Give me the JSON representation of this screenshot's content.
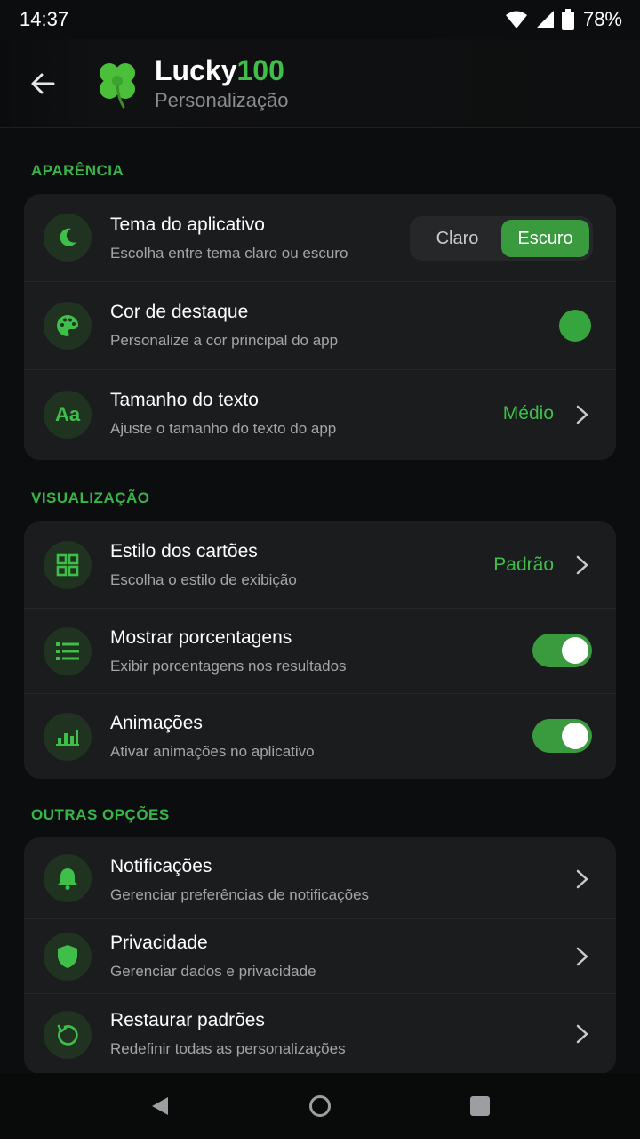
{
  "status_bar": {
    "time": "14:37",
    "battery_pct": "78%"
  },
  "app_bar": {
    "name_prefix": "Lucky",
    "name_suffix": "100",
    "subtitle": "Personalização",
    "icons": {
      "back": "arrow-left-icon",
      "logo": "four-leaf-clover-icon"
    }
  },
  "sections": {
    "appearance": {
      "header": "APARÊNCIA",
      "theme": {
        "title": "Tema do aplicativo",
        "subtitle": "Escolha entre tema claro ou escuro",
        "option_light": "Claro",
        "option_dark": "Escuro",
        "selected": "Escuro",
        "icon": "moon-icon"
      },
      "accent": {
        "title": "Cor de destaque",
        "subtitle": "Personalize a cor principal do app",
        "color": "#37a53d",
        "icon": "palette-icon"
      },
      "text_size": {
        "title": "Tamanho do texto",
        "subtitle": "Ajuste o tamanho do texto do app",
        "value": "Médio",
        "icon_label": "Aa"
      }
    },
    "display": {
      "header": "VISUALIZAÇÃO",
      "card_style": {
        "title": "Estilo dos cartões",
        "subtitle": "Escolha o estilo de exibição",
        "value": "Padrão",
        "icon": "grid-icon"
      },
      "percentages": {
        "title": "Mostrar porcentagens",
        "subtitle": "Exibir porcentagens nos resultados",
        "enabled": true,
        "icon": "list-icon"
      },
      "animations": {
        "title": "Animações",
        "subtitle": "Ativar animações no aplicativo",
        "enabled": true,
        "icon": "bar-chart-icon"
      }
    },
    "other": {
      "header": "OUTRAS OPÇÕES",
      "notifications": {
        "title": "Notificações",
        "subtitle": "Gerenciar preferências de notificações",
        "icon": "bell-icon"
      },
      "privacy": {
        "title": "Privacidade",
        "subtitle": "Gerenciar dados e privacidade",
        "icon": "shield-icon"
      },
      "restore": {
        "title": "Restaurar padrões",
        "subtitle": "Redefinir todas as personalizações",
        "icon": "restore-icon"
      }
    }
  },
  "colors": {
    "accent": "#3fbf4a",
    "background": "#0c0d0e",
    "card": "#1a1c1e"
  }
}
